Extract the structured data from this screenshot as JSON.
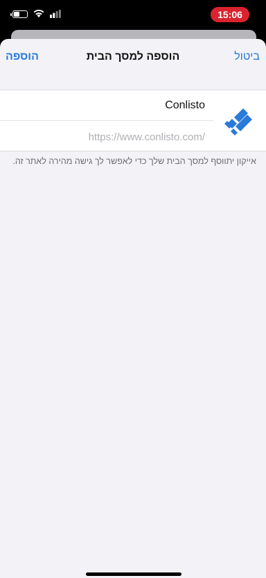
{
  "status_bar": {
    "time": "15:06",
    "battery_level": 0.45,
    "icons": [
      "battery-icon",
      "wifi-icon",
      "cellular-signal-icon"
    ],
    "time_pill_color": "#d9232e"
  },
  "nav": {
    "cancel_label": "ביטול",
    "title": "הוספה למסך הבית",
    "add_label": "הוספה"
  },
  "form": {
    "app_icon": "conlisto-logo-icon",
    "name_value": "Conlisto",
    "url_value": "https://www.conlisto.com/"
  },
  "note": "אייקון יתווסף למסך הבית שלך כדי לאפשר לך גישה מהירה לאתר זה.",
  "colors": {
    "accent": "#2a7ad8",
    "sheet_background": "#f2f2f7"
  }
}
